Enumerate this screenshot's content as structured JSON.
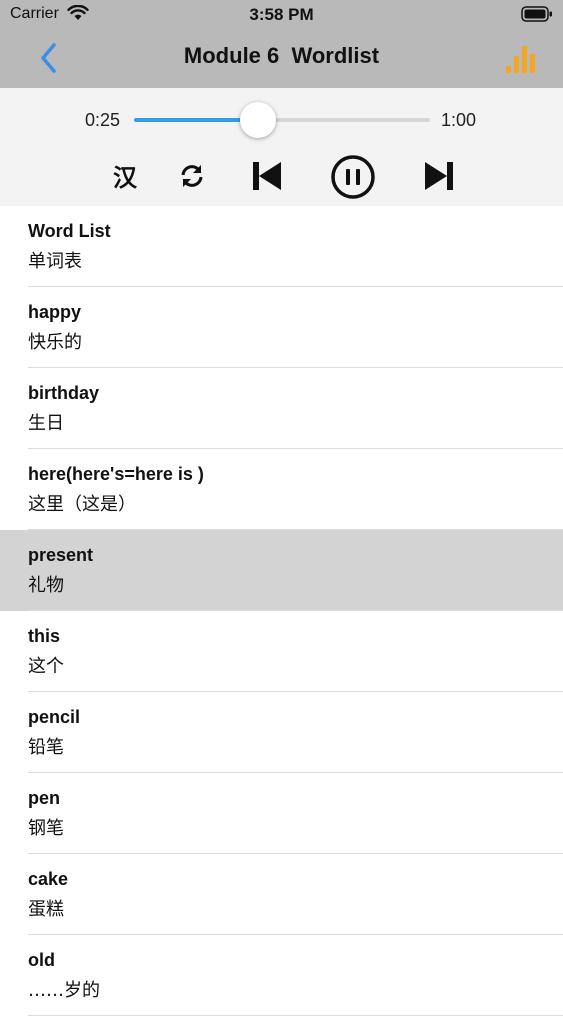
{
  "status_bar": {
    "carrier": "Carrier",
    "time": "3:58 PM"
  },
  "nav": {
    "title": "Module 6  Wordlist",
    "back_icon": "chevron-left-icon",
    "right_icon": "bar-chart-icon",
    "back_color": "#3a8ee6",
    "right_color": "#f5a623"
  },
  "player": {
    "current_time": "0:25",
    "total_time": "1:00",
    "progress": 0.42,
    "language_toggle": "汉",
    "accent": "#2f9ee6"
  },
  "words": [
    {
      "en": "Word List",
      "zh": "单词表"
    },
    {
      "en": "happy",
      "zh": "快乐的"
    },
    {
      "en": "birthday",
      "zh": "生日"
    },
    {
      "en": "here(here's=here is )",
      "zh": "这里（这是）"
    },
    {
      "en": "present",
      "zh": "礼物",
      "selected": true
    },
    {
      "en": "this",
      "zh": "这个"
    },
    {
      "en": "pencil",
      "zh": "铅笔"
    },
    {
      "en": "pen",
      "zh": "钢笔"
    },
    {
      "en": "cake",
      "zh": "蛋糕"
    },
    {
      "en": "old",
      "zh": "……岁的"
    }
  ]
}
